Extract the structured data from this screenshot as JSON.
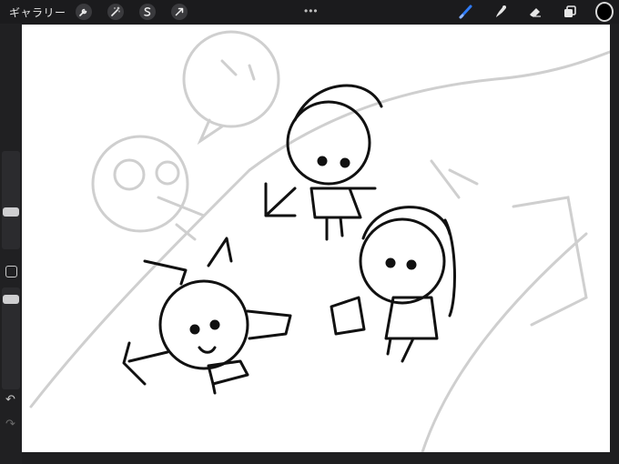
{
  "topbar": {
    "gallery_label": "ギャラリー",
    "menu_dots": "•••",
    "tools_left": [
      "wrench-icon",
      "magic-wand-icon",
      "selection-icon",
      "transform-icon"
    ],
    "tools_right": [
      "brush-icon",
      "smudge-icon",
      "eraser-icon",
      "layers-icon"
    ],
    "current_color": "#000000"
  },
  "sidebar": {
    "undo_icon": "↶",
    "redo_icon": "↷"
  },
  "colors": {
    "accent": "#2f7bf6",
    "canvas_bg": "#ffffff",
    "chrome_bg": "#1e1e20"
  }
}
